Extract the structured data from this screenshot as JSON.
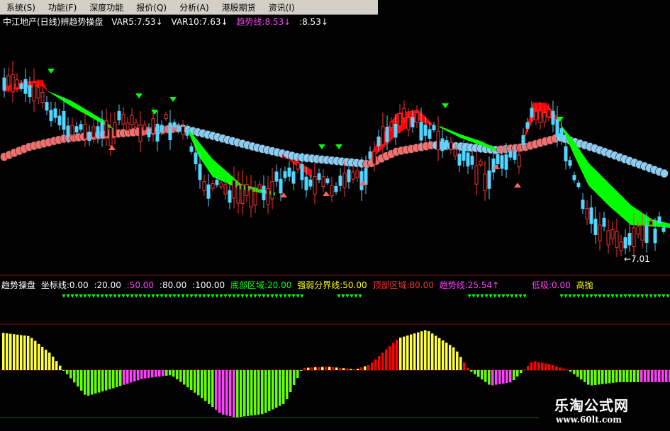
{
  "menu": [
    "系统(S)",
    "功能(F)",
    "深度功能",
    "报价(Q)",
    "分析(A)",
    "港股期货",
    "资讯(I)"
  ],
  "main_panel": {
    "stock": "中江地产(日线)",
    "indicator": "辨趋势操盘",
    "var5": "VAR5:7.53↓",
    "var10": "VAR10:7.63↓",
    "trend_line": "趋势线:8.53↓",
    "value2": ":8.53↓",
    "low_marker": "←7.01"
  },
  "sub_panel": {
    "name": "趋势操盘",
    "coord": "坐标线:0.00",
    "v20": ":20.00",
    "v50": ":50.00",
    "v80": ":80.00",
    "v100": ":100.00",
    "bottom_zone": "底部区域:20.00",
    "split_line": "强弱分界线:50.00",
    "top_zone": "顶部区域:80.00",
    "trend_line": "趋势线:25.54↑",
    "low_buy": "低吸:0.00",
    "high_sell": "高抛"
  },
  "colors": {
    "background": "#000000",
    "up_candle": "#ff3030",
    "down_candle": "#54d4ff",
    "ribbon_green": "#00ff00",
    "ribbon_red": "#ff0000",
    "bar_red": "#ff0000",
    "bar_yellow": "#ffff40",
    "bar_green": "#66ff00",
    "bar_magenta": "#ff40ff",
    "label_white": "#ffffff",
    "label_yellow": "#ffff00",
    "label_magenta": "#ff40ff",
    "label_cyan": "#00ffff",
    "label_green": "#00ff00",
    "label_red": "#ff3030"
  },
  "watermark": {
    "title": "乐淘公式网",
    "url": "www.60lt.com"
  }
}
